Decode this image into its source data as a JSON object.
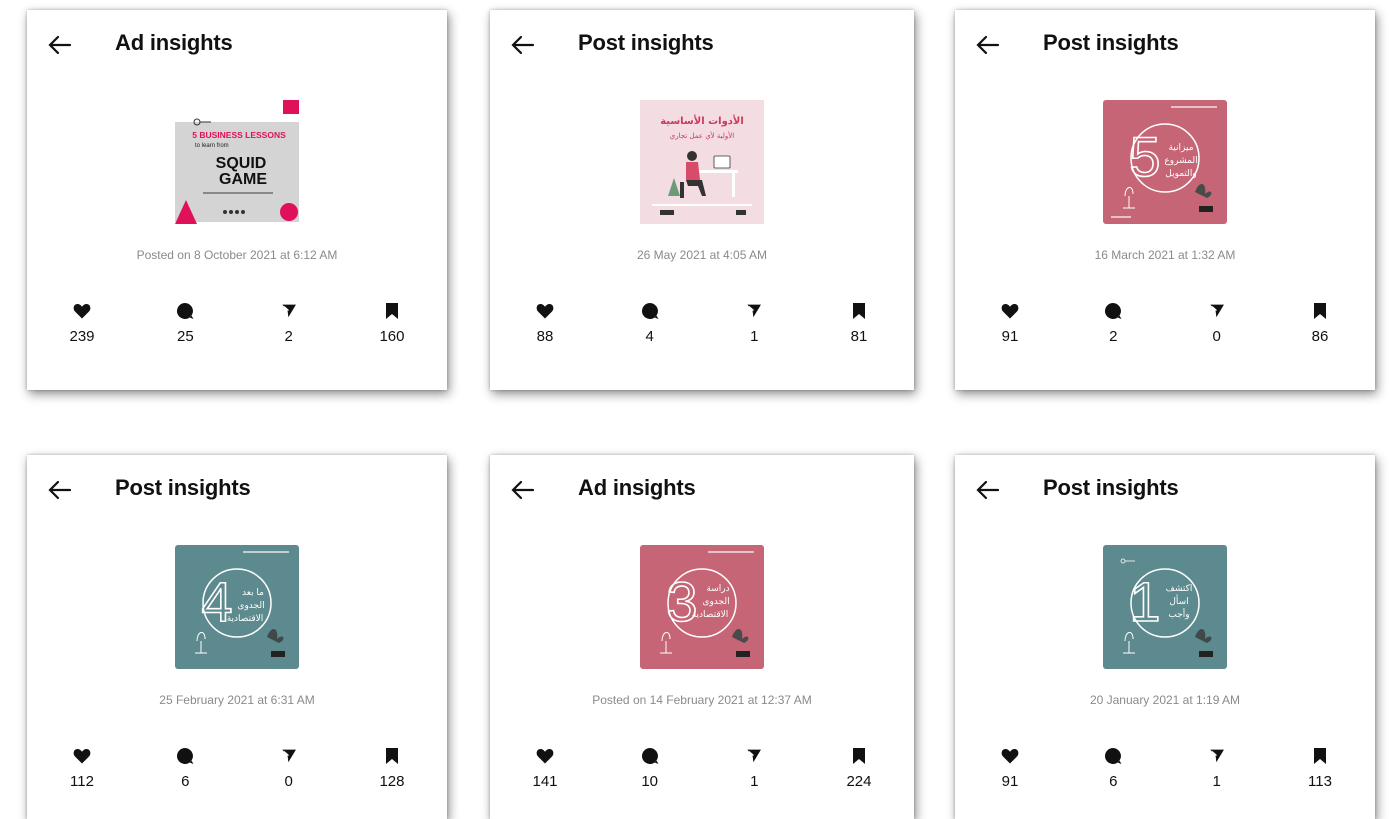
{
  "colors": {
    "title": "#111111",
    "date": "#8a8a8a",
    "rose": "#c56575",
    "teal": "#5c8a8e",
    "light_pink": "#f4dde2",
    "magenta": "#e0105a"
  },
  "icons": {
    "back": "arrow-left-icon",
    "likes": "heart-icon",
    "comments": "comment-bubble-icon",
    "shares": "send-icon",
    "saves": "bookmark-icon"
  },
  "cards": [
    {
      "title": "Ad insights",
      "date": "Posted on 8 October 2021 at 6:12 AM",
      "thumb": {
        "style": "squid",
        "top_text": "5 BUSINESS LESSONS",
        "sub_text": "to learn from",
        "main_text_1": "SQUID",
        "main_text_2": "GAME"
      },
      "stats": {
        "likes": "239",
        "comments": "25",
        "shares": "2",
        "saves": "160"
      }
    },
    {
      "title": "Post insights",
      "date": "26 May 2021 at 4:05 AM",
      "thumb": {
        "style": "pink-illustration",
        "line_1": "الأدوات الأساسية",
        "line_2": "الأولية لأي عمل تجاري"
      },
      "stats": {
        "likes": "88",
        "comments": "4",
        "shares": "1",
        "saves": "81"
      }
    },
    {
      "title": "Post insights",
      "date": "16 March 2021 at 1:32 AM",
      "thumb": {
        "style": "rose",
        "numeral": "5",
        "line_1": "ميزانية",
        "line_2": "المشروع",
        "line_3": "والتمويل"
      },
      "stats": {
        "likes": "91",
        "comments": "2",
        "shares": "0",
        "saves": "86"
      }
    },
    {
      "title": "Post insights",
      "date": "25 February 2021 at 6:31 AM",
      "thumb": {
        "style": "teal",
        "numeral": "4",
        "line_1": "ما بعد",
        "line_2": "الجدوى",
        "line_3": "الاقتصادية"
      },
      "stats": {
        "likes": "112",
        "comments": "6",
        "shares": "0",
        "saves": "128"
      }
    },
    {
      "title": "Ad insights",
      "date": "Posted on 14 February 2021 at 12:37 AM",
      "thumb": {
        "style": "rose",
        "numeral": "3",
        "line_1": "دراسة",
        "line_2": "الجدوى",
        "line_3": "الاقتصادية"
      },
      "stats": {
        "likes": "141",
        "comments": "10",
        "shares": "1",
        "saves": "224"
      }
    },
    {
      "title": "Post insights",
      "date": "20 January 2021 at 1:19 AM",
      "thumb": {
        "style": "teal",
        "numeral": "1",
        "line_1": "اكتشف",
        "line_2": "اسأل",
        "line_3": "وأجب"
      },
      "stats": {
        "likes": "91",
        "comments": "6",
        "shares": "1",
        "saves": "113"
      }
    }
  ]
}
